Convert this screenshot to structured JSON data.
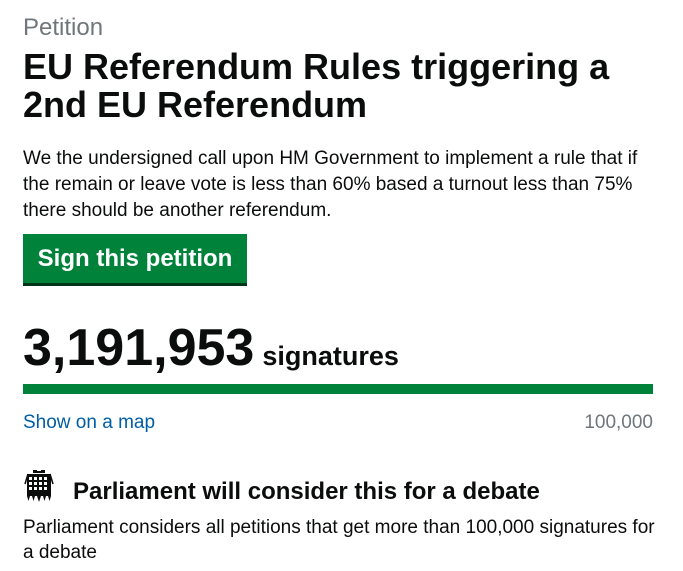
{
  "petition": {
    "kicker": "Petition",
    "title": "EU Referendum Rules triggering a 2nd EU Referendum",
    "description": "We the undersigned call upon HM Government to implement a rule that if the remain or leave vote is less than 60% based a turnout less than 75% there should be another referendum.",
    "sign_button": "Sign this petition"
  },
  "signatures": {
    "count": "3,191,953",
    "label": "signatures",
    "progress_fraction": 1.0,
    "map_link": "Show on a map",
    "threshold": "100,000"
  },
  "debate": {
    "icon": "portcullis-icon",
    "heading": "Parliament will consider this for a debate",
    "text": "Parliament considers all petitions that get more than 100,000 signatures for a debate"
  },
  "colors": {
    "accent_green": "#00823b",
    "link_blue": "#005ea5",
    "secondary_text": "#6f777b"
  }
}
